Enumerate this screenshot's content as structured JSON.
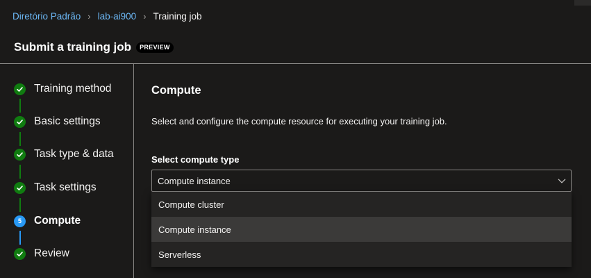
{
  "breadcrumb": {
    "items": [
      "Diretório Padrão",
      "lab-ai900"
    ],
    "current": "Training job"
  },
  "header": {
    "title": "Submit a training job",
    "badge": "PREVIEW"
  },
  "steps": [
    {
      "label": "Training method",
      "status": "completed"
    },
    {
      "label": "Basic settings",
      "status": "completed"
    },
    {
      "label": "Task type & data",
      "status": "completed"
    },
    {
      "label": "Task settings",
      "status": "completed"
    },
    {
      "label": "Compute",
      "status": "current",
      "number": "5"
    },
    {
      "label": "Review",
      "status": "completed"
    }
  ],
  "main": {
    "title": "Compute",
    "description": "Select and configure the compute resource for executing your training job.",
    "compute_type": {
      "label": "Select compute type",
      "value": "Compute instance",
      "options": [
        "Compute cluster",
        "Compute instance",
        "Serverless"
      ],
      "selected_index": 1
    }
  },
  "colors": {
    "accent_link": "#6cb8f6",
    "step_done": "#107c10",
    "step_current": "#2899f5",
    "background": "#1b1a19"
  },
  "icons": {
    "breadcrumb_separator": "chevron-right-icon",
    "step_done": "checkmark-icon",
    "dropdown": "chevron-down-icon"
  }
}
